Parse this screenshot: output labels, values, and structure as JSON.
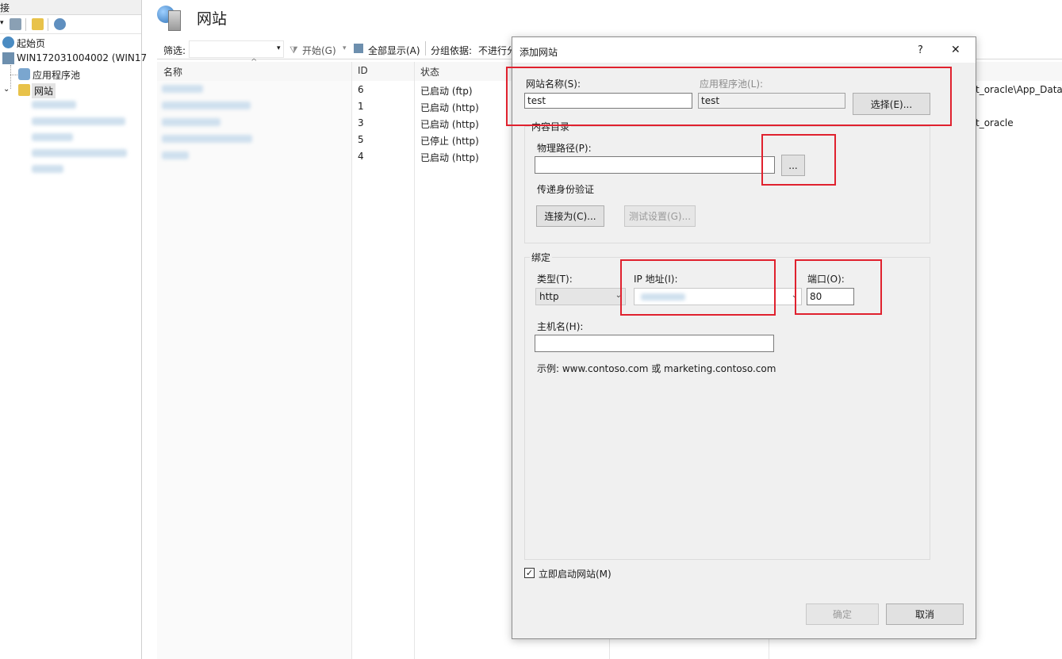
{
  "left_pane": {
    "header": "接",
    "tree": {
      "start_page": "起始页",
      "server": "WIN172031004002 (WIN17",
      "app_pools": "应用程序池",
      "sites": "网站"
    }
  },
  "main": {
    "title": "网站",
    "filter": {
      "label": "筛选:",
      "start": "开始(G)",
      "show_all": "全部显示(A)",
      "group_by_label": "分组依据:",
      "group_by_value": "不进行分"
    },
    "columns": {
      "name": "名称",
      "id": "ID",
      "status": "状态"
    },
    "rows": [
      {
        "id": "6",
        "status": "已启动 (ftp)"
      },
      {
        "id": "1",
        "status": "已启动 (http)"
      },
      {
        "id": "3",
        "status": "已启动 (http)"
      },
      {
        "id": "5",
        "status": "已停止 (http)"
      },
      {
        "id": "4",
        "status": "已启动 (http)"
      }
    ],
    "right_path_1": "t_oracle\\App_Data\\",
    "right_path_2": "t_oracle"
  },
  "dialog": {
    "title": "添加网站",
    "help": "?",
    "close": "✕",
    "site_name_label": "网站名称(S):",
    "site_name_value": "test",
    "app_pool_label": "应用程序池(L):",
    "app_pool_value": "test",
    "select_button": "选择(E)...",
    "content_dir_title": "内容目录",
    "physical_path_label": "物理路径(P):",
    "physical_path_value": "",
    "browse_button": "...",
    "pass_auth_label": "传递身份验证",
    "connect_as_button": "连接为(C)...",
    "test_settings_button": "测试设置(G)...",
    "binding_title": "绑定",
    "type_label": "类型(T):",
    "type_value": "http",
    "ip_label": "IP 地址(I):",
    "port_label": "端口(O):",
    "port_value": "80",
    "host_label": "主机名(H):",
    "host_value": "",
    "example_text": "示例: www.contoso.com 或 marketing.contoso.com",
    "start_now_label": "立即启动网站(M)",
    "ok_button": "确定",
    "cancel_button": "取消"
  }
}
